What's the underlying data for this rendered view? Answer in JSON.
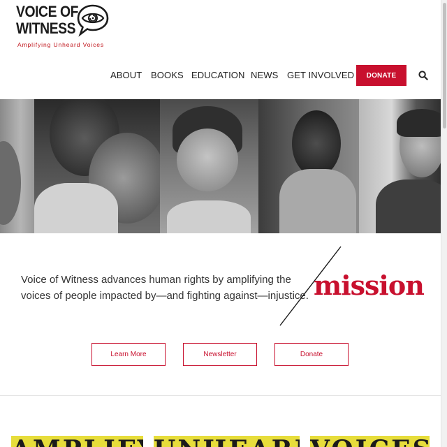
{
  "logo": {
    "line1": "VOICE OF",
    "line2": "WITNESS",
    "tagline": "Amplifying Unheard Voices"
  },
  "nav": {
    "items": [
      "ABOUT",
      "BOOKS",
      "EDUCATION",
      "NEWS",
      "GET INVOLVED"
    ],
    "donate_label": "DONATE",
    "search_icon": "search-icon"
  },
  "mission": {
    "text": "Voice of Witness advances human rights by amplifying the voices of people impacted by—and fighting against—injustice.",
    "heading": "mission"
  },
  "buttons": {
    "learn_more": "Learn More",
    "newsletter": "Newsletter",
    "donate": "Donate"
  },
  "banner": {
    "words": [
      "AMPLIFY",
      "UNHEARD",
      "VOICES"
    ]
  },
  "colors": {
    "accent": "#c8102e",
    "banner_yellow": "#e7dd3b"
  }
}
